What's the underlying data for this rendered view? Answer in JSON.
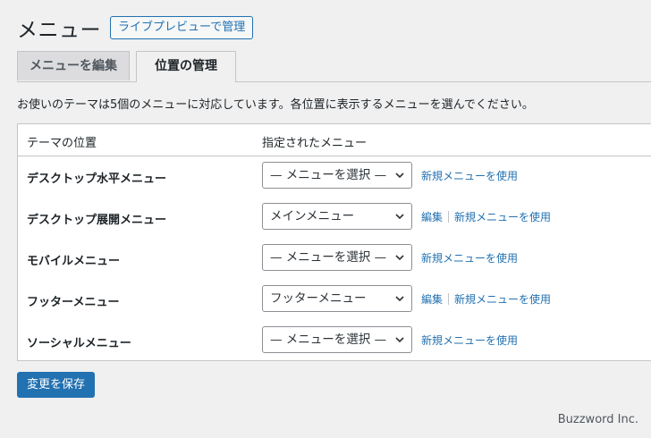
{
  "header": {
    "title": "メニュー",
    "manage_button": "ライブプレビューで管理"
  },
  "tabs": [
    {
      "label": "メニューを編集",
      "active": false
    },
    {
      "label": "位置の管理",
      "active": true
    }
  ],
  "description": "お使いのテーマは5個のメニューに対応しています。各位置に表示するメニューを選んでください。",
  "table": {
    "col_location": "テーマの位置",
    "col_menu": "指定されたメニュー",
    "rows": [
      {
        "label": "デスクトップ水平メニュー",
        "selected": "— メニューを選択 —",
        "edit": "",
        "use_new": "新規メニューを使用"
      },
      {
        "label": "デスクトップ展開メニュー",
        "selected": "メインメニュー",
        "edit": "編集",
        "use_new": "新規メニューを使用"
      },
      {
        "label": "モバイルメニュー",
        "selected": "— メニューを選択 —",
        "edit": "",
        "use_new": "新規メニューを使用"
      },
      {
        "label": "フッターメニュー",
        "selected": "フッターメニュー",
        "edit": "編集",
        "use_new": "新規メニューを使用"
      },
      {
        "label": "ソーシャルメニュー",
        "selected": "— メニューを選択 —",
        "edit": "",
        "use_new": "新規メニューを使用"
      }
    ]
  },
  "save_button": "変更を保存",
  "watermark": "Buzzword Inc.",
  "colors": {
    "accent": "#2271b1",
    "background": "#f0f0f1"
  }
}
